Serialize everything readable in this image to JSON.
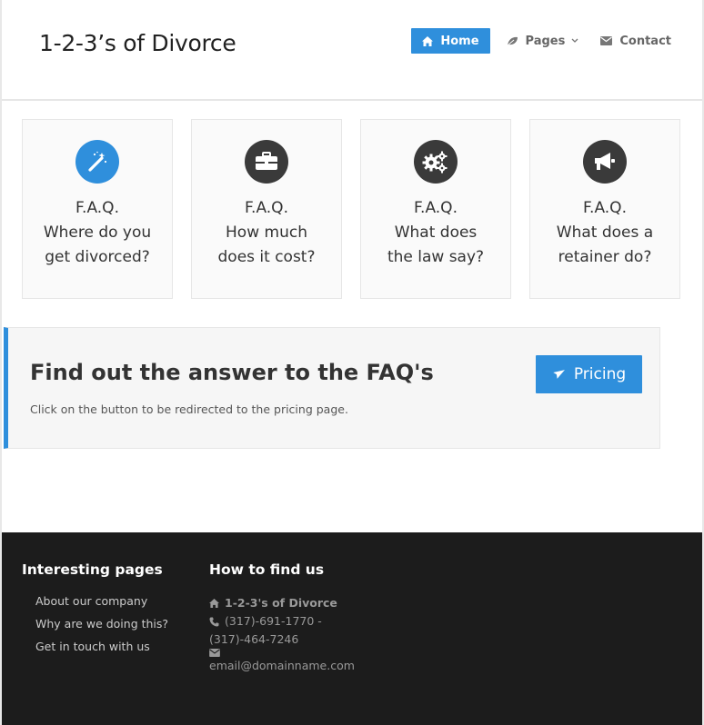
{
  "brand": "1-2-3’s of Divorce",
  "nav": {
    "home": "Home",
    "pages": "Pages",
    "contact": "Contact"
  },
  "features": [
    {
      "label": "F.A.Q.",
      "line1": "Where do you",
      "line2": "get divorced?",
      "icon": "magic-wand-icon"
    },
    {
      "label": "F.A.Q.",
      "line1": "How much",
      "line2": "does it cost?",
      "icon": "briefcase-icon"
    },
    {
      "label": "F.A.Q.",
      "line1": "What does",
      "line2": "the law say?",
      "icon": "gears-icon"
    },
    {
      "label": "F.A.Q.",
      "line1": "What does a",
      "line2": "retainer do?",
      "icon": "megaphone-icon"
    }
  ],
  "cta": {
    "title": "Find out the answer to the FAQ's",
    "text": "Click on the button to be redirected to the pricing page.",
    "button": "Pricing"
  },
  "footer": {
    "col1_heading": "Interesting pages",
    "links": [
      "About our company",
      "Why are we doing this?",
      "Get in touch with us"
    ],
    "col2_heading": "How to find us",
    "company": "1-2-3's of Divorce",
    "phone_line1": "(317)-691-1770 -",
    "phone_line2": "(317)-464-7246",
    "email": "email@domainname.com"
  },
  "colors": {
    "accent": "#2f8fdc",
    "dark_icon": "#3a3a3a",
    "footer_bg": "#1c1c1c"
  }
}
